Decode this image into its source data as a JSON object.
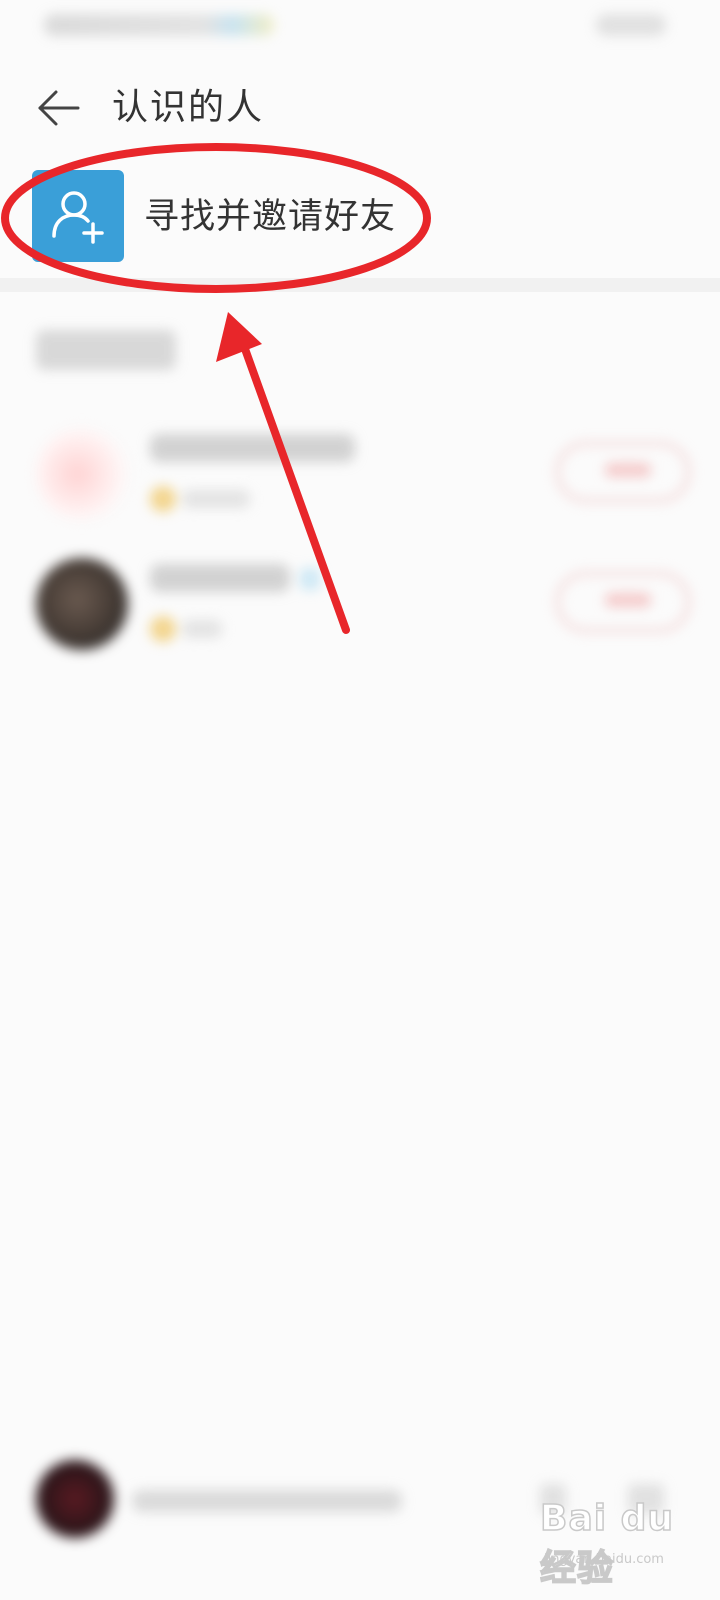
{
  "header": {
    "back_icon": "arrow-left-icon",
    "title": "认识的人"
  },
  "invite": {
    "icon": "add-user-icon",
    "icon_color": "#3a9fd8",
    "label": "寻找并邀请好友"
  },
  "annotation": {
    "color": "#e8262a",
    "shapes": [
      "ellipse-highlight",
      "arrow-pointer"
    ]
  },
  "watermark": {
    "brand": "Bai du 经验",
    "url": "jingyan.baidu.com"
  }
}
